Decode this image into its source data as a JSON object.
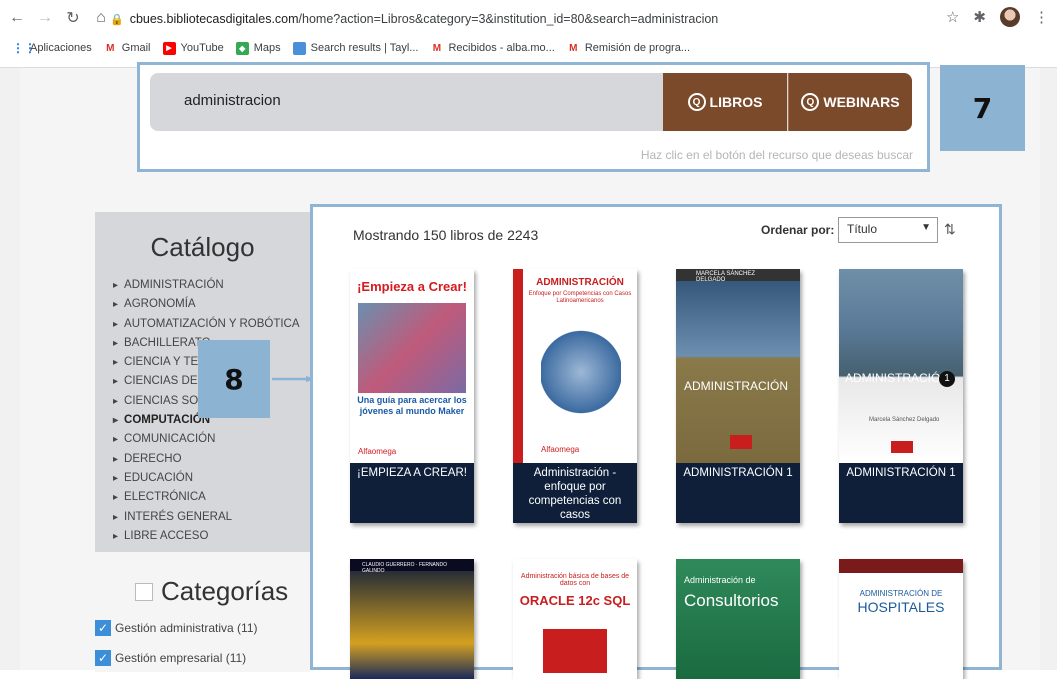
{
  "browser": {
    "url_domain": "cbues.bibliotecasdigitales.com",
    "url_rest": "/home?action=Libros&category=3&institution_id=80&search=administracion",
    "bookmarks": [
      "Aplicaciones",
      "Gmail",
      "YouTube",
      "Maps",
      "Search results | Tayl...",
      "Recibidos - alba.mo...",
      "Remisión de progra..."
    ]
  },
  "search": {
    "query": "administracion",
    "btn_libros": "LIBROS",
    "btn_webinars": "WEBINARS",
    "hint": "Haz clic en el botón del recurso que deseas buscar"
  },
  "annotations": {
    "box7": "7",
    "box8": "8"
  },
  "catalog": {
    "title": "Catálogo",
    "items": [
      "ADMINISTRACIÓN",
      "AGRONOMÍA",
      "AUTOMATIZACIÓN Y ROBÓTICA",
      "BACHILLERATO",
      "CIENCIA Y TECNOLOGÍA",
      "CIENCIAS DE LA SALUD",
      "CIENCIAS SOCIALES",
      "COMPUTACIÓN",
      "COMUNICACIÓN",
      "DERECHO",
      "EDUCACIÓN",
      "ELECTRÓNICA",
      "INTERÉS GENERAL",
      "LIBRE ACCESO"
    ]
  },
  "categories": {
    "title": "Categorías",
    "items": [
      "Gestión administrativa (11)",
      "Gestión empresarial (11)"
    ]
  },
  "results": {
    "showing": "Mostrando 150 libros de 2243",
    "sort_label": "Ordenar por:",
    "sort_value": "Título",
    "books": [
      {
        "caption": "¡EMPIEZA A CREAR!",
        "cover_title": "¡Empieza a Crear!",
        "cover_sub": "Una guía para acercar los jóvenes al mundo Maker",
        "publisher": "Alfaomega"
      },
      {
        "caption": "Administración - enfoque por competencias con casos latinoamericanos",
        "cover_title": "ADMINISTRACIÓN",
        "cover_sub": "Enfoque por Competencias con Casos Latinoamericanos",
        "publisher": "Alfaomega"
      },
      {
        "caption": "ADMINISTRACIÓN 1",
        "cover_title": "ADMINISTRACIÓN",
        "cover_sub": "MARCELA SÁNCHEZ DELGADO",
        "publisher": ""
      },
      {
        "caption": "ADMINISTRACIÓN 1",
        "cover_title": "ADMINISTRACIÓN",
        "cover_sub": "Marcela Sánchez Delgado",
        "publisher": ""
      }
    ],
    "row2": [
      {
        "cover_title": "CLAUDIO GUERRERO · FERNANDO GALINDO"
      },
      {
        "cover_title": "ORACLE 12c SQL",
        "cover_sub": "Administración básica de bases de datos con"
      },
      {
        "cover_title": "Consultorios",
        "cover_sub": "Administración de"
      },
      {
        "cover_title": "HOSPITALES",
        "cover_sub": "ADMINISTRACIÓN DE"
      }
    ]
  }
}
